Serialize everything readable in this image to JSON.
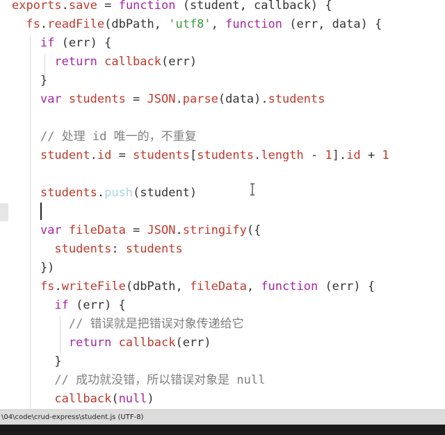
{
  "editor": {
    "lines": [
      [
        {
          "c": "prop",
          "t": "exports"
        },
        {
          "c": "pl",
          "t": "."
        },
        {
          "c": "fn",
          "t": "save"
        },
        {
          "c": "pl",
          "t": " = "
        },
        {
          "c": "kw",
          "t": "function"
        },
        {
          "c": "pl",
          "t": " (student, callback) {"
        }
      ],
      [
        {
          "c": "pl",
          "t": "  "
        },
        {
          "c": "prop",
          "t": "fs"
        },
        {
          "c": "pl",
          "t": "."
        },
        {
          "c": "fn",
          "t": "readFile"
        },
        {
          "c": "pl",
          "t": "(dbPath, "
        },
        {
          "c": "str",
          "t": "'utf8'"
        },
        {
          "c": "pl",
          "t": ", "
        },
        {
          "c": "kw",
          "t": "function"
        },
        {
          "c": "pl",
          "t": " (err, data) {"
        }
      ],
      [
        {
          "c": "pl",
          "t": "    "
        },
        {
          "c": "kw",
          "t": "if"
        },
        {
          "c": "pl",
          "t": " (err) {"
        }
      ],
      [
        {
          "c": "pl",
          "t": "      "
        },
        {
          "c": "kw",
          "t": "return"
        },
        {
          "c": "pl",
          "t": " "
        },
        {
          "c": "fn",
          "t": "callback"
        },
        {
          "c": "pl",
          "t": "(err)"
        }
      ],
      [
        {
          "c": "pl",
          "t": "    }"
        }
      ],
      [
        {
          "c": "pl",
          "t": "    "
        },
        {
          "c": "kw",
          "t": "var"
        },
        {
          "c": "pl",
          "t": " "
        },
        {
          "c": "prop",
          "t": "students"
        },
        {
          "c": "pl",
          "t": " = "
        },
        {
          "c": "prop",
          "t": "JSON"
        },
        {
          "c": "pl",
          "t": "."
        },
        {
          "c": "fn",
          "t": "parse"
        },
        {
          "c": "pl",
          "t": "(data)."
        },
        {
          "c": "prop",
          "t": "students"
        }
      ],
      [],
      [
        {
          "c": "pl",
          "t": "    "
        },
        {
          "c": "cm",
          "t": "// 处理 id 唯一的，不重复"
        }
      ],
      [
        {
          "c": "pl",
          "t": "    "
        },
        {
          "c": "prop",
          "t": "student"
        },
        {
          "c": "pl",
          "t": "."
        },
        {
          "c": "prop",
          "t": "id"
        },
        {
          "c": "pl",
          "t": " = "
        },
        {
          "c": "prop",
          "t": "students"
        },
        {
          "c": "pl",
          "t": "["
        },
        {
          "c": "prop",
          "t": "students"
        },
        {
          "c": "pl",
          "t": "."
        },
        {
          "c": "prop",
          "t": "length"
        },
        {
          "c": "pl",
          "t": " - "
        },
        {
          "c": "num",
          "t": "1"
        },
        {
          "c": "pl",
          "t": "]."
        },
        {
          "c": "prop",
          "t": "id"
        },
        {
          "c": "pl",
          "t": " + "
        },
        {
          "c": "num",
          "t": "1"
        }
      ],
      [],
      [
        {
          "c": "pl",
          "t": "    "
        },
        {
          "c": "prop",
          "t": "students"
        },
        {
          "c": "pl",
          "t": "."
        },
        {
          "c": "faint",
          "t": "push"
        },
        {
          "c": "pl",
          "t": "(student)"
        }
      ],
      [],
      [
        {
          "c": "pl",
          "t": "    "
        },
        {
          "c": "kw",
          "t": "var"
        },
        {
          "c": "pl",
          "t": " "
        },
        {
          "c": "prop",
          "t": "fileData"
        },
        {
          "c": "pl",
          "t": " = "
        },
        {
          "c": "prop",
          "t": "JSON"
        },
        {
          "c": "pl",
          "t": "."
        },
        {
          "c": "fn",
          "t": "stringify"
        },
        {
          "c": "pl",
          "t": "({"
        }
      ],
      [
        {
          "c": "pl",
          "t": "      "
        },
        {
          "c": "prop",
          "t": "students"
        },
        {
          "c": "pl",
          "t": ": "
        },
        {
          "c": "prop",
          "t": "students"
        }
      ],
      [
        {
          "c": "pl",
          "t": "    })"
        }
      ],
      [
        {
          "c": "pl",
          "t": "    "
        },
        {
          "c": "prop",
          "t": "fs"
        },
        {
          "c": "pl",
          "t": "."
        },
        {
          "c": "fn",
          "t": "writeFile"
        },
        {
          "c": "pl",
          "t": "(dbPath, "
        },
        {
          "c": "prop",
          "t": "fileData"
        },
        {
          "c": "pl",
          "t": ", "
        },
        {
          "c": "kw",
          "t": "function"
        },
        {
          "c": "pl",
          "t": " (err) {"
        }
      ],
      [
        {
          "c": "pl",
          "t": "      "
        },
        {
          "c": "kw",
          "t": "if"
        },
        {
          "c": "pl",
          "t": " (err) {"
        }
      ],
      [
        {
          "c": "pl",
          "t": "        "
        },
        {
          "c": "cm",
          "t": "// 错误就是把错误对象传递给它"
        }
      ],
      [
        {
          "c": "pl",
          "t": "        "
        },
        {
          "c": "kw",
          "t": "return"
        },
        {
          "c": "pl",
          "t": " "
        },
        {
          "c": "fn",
          "t": "callback"
        },
        {
          "c": "pl",
          "t": "(err)"
        }
      ],
      [
        {
          "c": "pl",
          "t": "      }"
        }
      ],
      [
        {
          "c": "pl",
          "t": "      "
        },
        {
          "c": "cm",
          "t": "// 成功就没错，所以错误对象是 null"
        }
      ],
      [
        {
          "c": "pl",
          "t": "      "
        },
        {
          "c": "fn",
          "t": "callback"
        },
        {
          "c": "pl",
          "t": "("
        },
        {
          "c": "kw",
          "t": "null"
        },
        {
          "c": "pl",
          "t": ")"
        }
      ]
    ]
  },
  "statusbar": {
    "text": "\\04\\code\\crud-express\\student.js (UTF-8)"
  },
  "colors": {
    "keyword": "#a626a4",
    "identifier": "#c0392b",
    "string": "#3a9a3a",
    "comment": "#7f7f7f",
    "plain": "#333333",
    "statusbar_bg": "#dcdcdc"
  }
}
